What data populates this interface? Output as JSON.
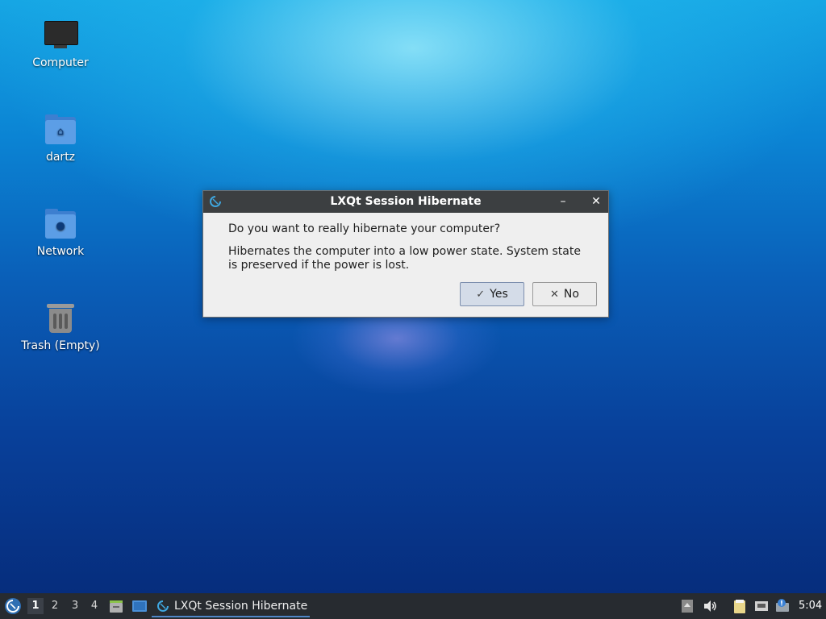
{
  "desktop": {
    "icons": [
      {
        "label": "Computer",
        "icon": "computer-monitor-icon"
      },
      {
        "label": "dartz",
        "icon": "home-folder-icon"
      },
      {
        "label": "Network",
        "icon": "network-folder-icon"
      },
      {
        "label": "Trash (Empty)",
        "icon": "trash-icon"
      }
    ]
  },
  "dialog": {
    "title": "LXQt Session Hibernate",
    "question": "Do you want to really hibernate your computer?",
    "description": "Hibernates the computer into a low power state. System state is preserved if the power is lost.",
    "yes_label": "Yes",
    "no_label": "No",
    "minimize_glyph": "–",
    "close_glyph": "✕"
  },
  "taskbar": {
    "desktops": [
      "1",
      "2",
      "3",
      "4"
    ],
    "active_desktop": "1",
    "task_label": "LXQt Session Hibernate",
    "clock": "5:04"
  },
  "colors": {
    "titlebar": "#3c3f41",
    "taskbar": "#272b30",
    "accent": "#4f86c6"
  }
}
